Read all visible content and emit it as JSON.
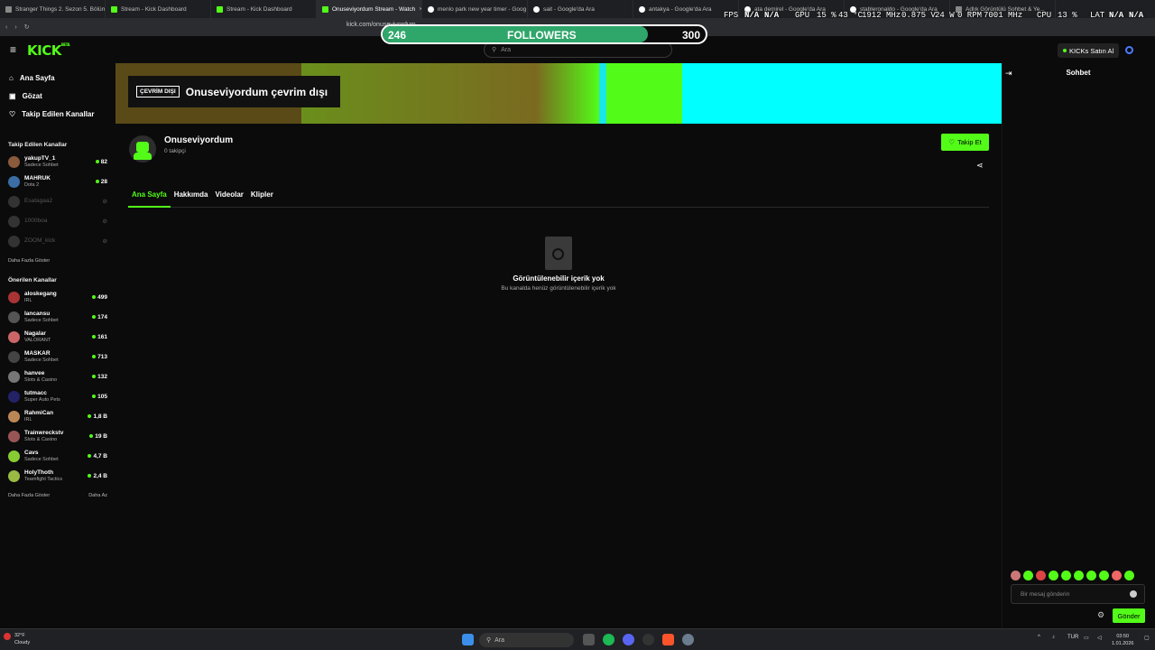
{
  "browser": {
    "tabs": [
      {
        "title": "Stranger Things 2. Sezon 5. Bölüm",
        "type": "other",
        "active": false
      },
      {
        "title": "Stream - Kick Dashboard",
        "type": "kick",
        "active": false
      },
      {
        "title": "Stream - Kick Dashboard",
        "type": "kick",
        "active": false
      },
      {
        "title": "Onuseviyordum Stream - Watch",
        "type": "kick",
        "active": true
      },
      {
        "title": "menlo park new year timer - Goog",
        "type": "google",
        "active": false
      },
      {
        "title": "sait - Google'da Ara",
        "type": "google",
        "active": false
      },
      {
        "title": "antakya - Google'da Ara",
        "type": "google",
        "active": false
      },
      {
        "title": "ata demirel - Google'da Ara",
        "type": "google",
        "active": false
      },
      {
        "title": "stableronaldo - Google'da Ara",
        "type": "google",
        "active": false
      },
      {
        "title": "Adlık Görüntülü Sohbet & Ye...",
        "type": "other",
        "active": false
      }
    ],
    "url": "kick.com/onuseviyordum"
  },
  "overlay": {
    "fps_label": "FPS",
    "fps_value": "N/A",
    "fps_value2": "N/A",
    "gpu_label": "GPU",
    "gpu_usage": "15 %",
    "gpu_temp": "43 °C",
    "gpu_clock": "1912 MHz",
    "gpu_volt": "0.875 V",
    "gpu_power": "24 W",
    "gpu_fan": "0 RPM",
    "cpu_clock": "7001 MHz",
    "cpu_label": "CPU",
    "cpu_usage": "13 %",
    "lat_label": "LAT",
    "lat_value": "N/A",
    "lat_value2": "N/A"
  },
  "followers_goal": {
    "current": "246",
    "label": "FOLLOWERS",
    "target": "300",
    "progress": 0.82
  },
  "header": {
    "logo": "KICK",
    "logo_tag": "BETA",
    "search_placeholder": "Ara",
    "kicks_button": "KICKs Satın Al"
  },
  "sidebar": {
    "nav": [
      {
        "label": "Ana Sayfa",
        "icon": "home-icon"
      },
      {
        "label": "Gözat",
        "icon": "browse-icon"
      },
      {
        "label": "Takip Edilen Kanallar",
        "icon": "heart-icon"
      }
    ],
    "followed_heading": "Takip Edilen Kanallar",
    "followed": [
      {
        "name": "yakupTV_1",
        "sub": "Sadece Sohbet",
        "viewers": "82",
        "live": true
      },
      {
        "name": "MAHRUK",
        "sub": "Dota 2",
        "viewers": "28",
        "live": true
      },
      {
        "name": "Esatagaa2",
        "sub": "",
        "viewers": "",
        "live": false
      },
      {
        "name": "1000boa",
        "sub": "",
        "viewers": "",
        "live": false
      },
      {
        "name": "ZOOM_kick",
        "sub": "",
        "viewers": "",
        "live": false
      }
    ],
    "show_more": "Daha Fazla Göster",
    "recommended_heading": "Önerilen Kanallar",
    "recommended": [
      {
        "name": "aloskegang",
        "sub": "IRL",
        "viewers": "499"
      },
      {
        "name": "lancansu",
        "sub": "Sadece Sohbet",
        "viewers": "174"
      },
      {
        "name": "Nagalar",
        "sub": "VALORANT",
        "viewers": "161"
      },
      {
        "name": "MASKAR",
        "sub": "Sadece Sohbet",
        "viewers": "713"
      },
      {
        "name": "hanvee",
        "sub": "Slots & Casino",
        "viewers": "132"
      },
      {
        "name": "tutmacc",
        "sub": "Super Auto Pets",
        "viewers": "105"
      },
      {
        "name": "RahmiCan",
        "sub": "IRL",
        "viewers": "1,8 B"
      },
      {
        "name": "Trainwreckstv",
        "sub": "Slots & Casino",
        "viewers": "19 B"
      },
      {
        "name": "Cavs",
        "sub": "Sadece Sohbet",
        "viewers": "4,7 B"
      },
      {
        "name": "HolyThoth",
        "sub": "Teamfight Tactics",
        "viewers": "2,4 B"
      }
    ],
    "show_more2": "Daha Fazla Göster",
    "show_less": "Daha Az"
  },
  "channel": {
    "offline_badge": "ÇEVRİM DIŞI",
    "offline_text": "Onuseviyordum çevrim dışı",
    "name": "Onuseviyordum",
    "followers": "0 takipçi",
    "follow_button": "Takip Et",
    "tabs": [
      "Ana Sayfa",
      "Hakkımda",
      "Videolar",
      "Klipler"
    ],
    "empty_title": "Görüntülenebilir içerik yok",
    "empty_sub": "Bu kanalda henüz görüntülenebilir içerik yok"
  },
  "chat": {
    "title": "Sohbet",
    "placeholder": "Bir mesaj gönderin",
    "send": "Gönder"
  },
  "taskbar": {
    "weather_temp": "32°F",
    "weather_desc": "Cloudy",
    "search": "Ara",
    "lang": "TUR",
    "time": "03:50",
    "date": "1.01.2026"
  }
}
